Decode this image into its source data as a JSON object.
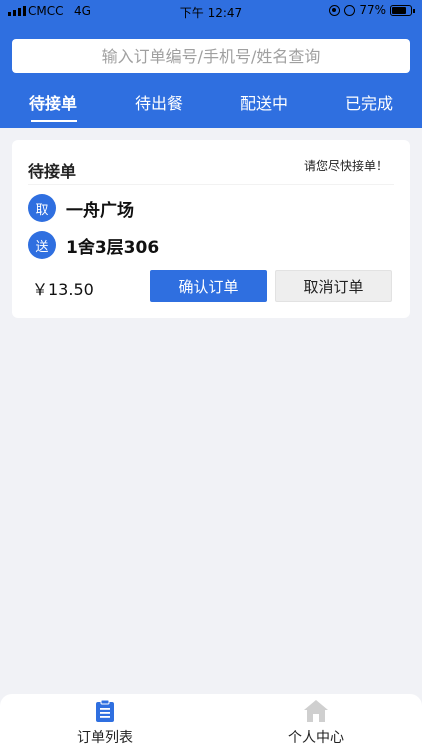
{
  "status_bar": {
    "carrier": "CMCC",
    "network": "4G",
    "time": "下午 12:47",
    "battery": "77%",
    "battery_level": 0.77
  },
  "search": {
    "placeholder": "输入订单编号/手机号/姓名查询"
  },
  "tabs": [
    {
      "label": "待接单",
      "active": true
    },
    {
      "label": "待出餐",
      "active": false
    },
    {
      "label": "配送中",
      "active": false
    },
    {
      "label": "已完成",
      "active": false
    }
  ],
  "order": {
    "status_title": "待接单",
    "hint": "请您尽快接单！",
    "pickup_badge": "取",
    "pickup_location": "一舟广场",
    "delivery_badge": "送",
    "delivery_location": "1舍3层306",
    "price": "￥13.50",
    "confirm_label": "确认订单",
    "cancel_label": "取消订单"
  },
  "bottom_nav": [
    {
      "label": "订单列表",
      "icon": "clipboard-list-icon",
      "active": true
    },
    {
      "label": "个人中心",
      "icon": "home-icon",
      "active": false
    }
  ],
  "colors": {
    "accent": "#2f6fe0",
    "background": "#f1f2f6",
    "inactive_icon": "#cfcfcf"
  }
}
